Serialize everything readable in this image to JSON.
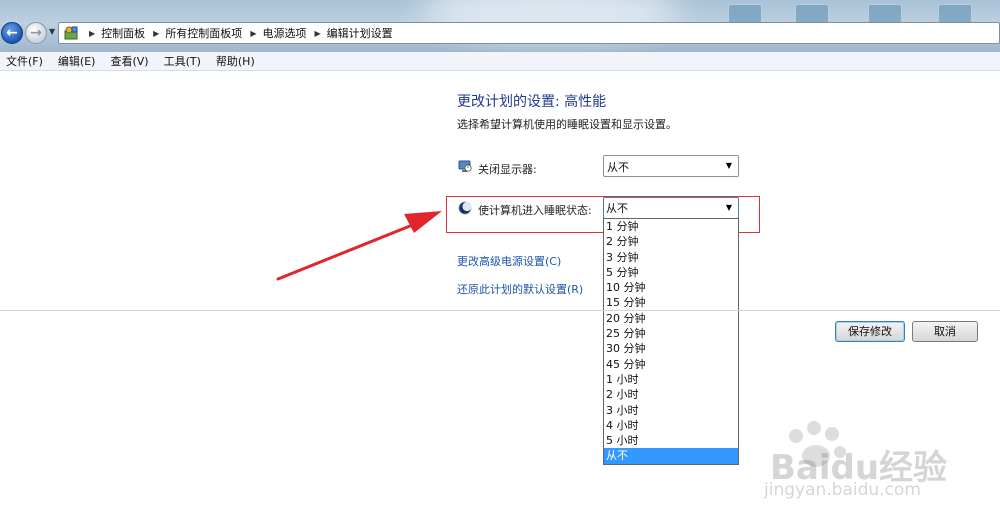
{
  "nav": {
    "breadcrumbs": [
      "控制面板",
      "所有控制面板项",
      "电源选项",
      "编辑计划设置"
    ]
  },
  "menu": [
    "文件(F)",
    "编辑(E)",
    "查看(V)",
    "工具(T)",
    "帮助(H)"
  ],
  "content": {
    "title": "更改计划的设置: 高性能",
    "subtitle": "选择希望计算机使用的睡眠设置和显示设置。",
    "display_label": "关闭显示器:",
    "display_value": "从不",
    "sleep_label": "使计算机进入睡眠状态:",
    "sleep_value": "从不",
    "sleep_options": [
      "1 分钟",
      "2 分钟",
      "3 分钟",
      "5 分钟",
      "10 分钟",
      "15 分钟",
      "20 分钟",
      "25 分钟",
      "30 分钟",
      "45 分钟",
      "1 小时",
      "2 小时",
      "3 小时",
      "4 小时",
      "5 小时",
      "从不"
    ],
    "selected_option": "从不",
    "link_advanced": "更改高级电源设置(C)",
    "link_restore": "还原此计划的默认设置(R)"
  },
  "buttons": {
    "save": "保存修改",
    "cancel": "取消"
  },
  "watermark": {
    "brand": "Baidu经验",
    "url": "jingyan.baidu.com"
  },
  "colors": {
    "title": "#1e3a8f",
    "link": "#1c56a8",
    "highlight": "#d8343a",
    "selection": "#3399ff"
  },
  "icons": {
    "back": "back-arrow-icon",
    "forward": "forward-arrow-icon",
    "address": "control-panel-icon",
    "display": "display-timer-icon",
    "sleep": "sleep-moon-icon"
  }
}
